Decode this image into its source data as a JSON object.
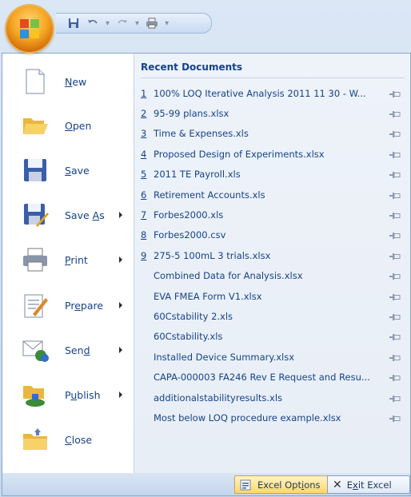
{
  "quick_access": {
    "icons": [
      "save-icon",
      "undo-icon",
      "redo-icon",
      "print-icon",
      "customize-icon"
    ]
  },
  "left_menu": [
    {
      "id": "new",
      "pre": "",
      "accel": "N",
      "post": "ew",
      "icon": "new-document-icon",
      "submenu": false
    },
    {
      "id": "open",
      "pre": "",
      "accel": "O",
      "post": "pen",
      "icon": "open-folder-icon",
      "submenu": false
    },
    {
      "id": "save",
      "pre": "",
      "accel": "S",
      "post": "ave",
      "icon": "save-disk-icon",
      "submenu": false
    },
    {
      "id": "save-as",
      "pre": "Save ",
      "accel": "A",
      "post": "s",
      "icon": "save-as-icon",
      "submenu": true
    },
    {
      "id": "print",
      "pre": "",
      "accel": "P",
      "post": "rint",
      "icon": "printer-icon",
      "submenu": true
    },
    {
      "id": "prepare",
      "pre": "Pr",
      "accel": "e",
      "post": "pare",
      "icon": "prepare-icon",
      "submenu": true
    },
    {
      "id": "send",
      "pre": "Sen",
      "accel": "d",
      "post": "",
      "icon": "send-icon",
      "submenu": true
    },
    {
      "id": "publish",
      "pre": "P",
      "accel": "u",
      "post": "blish",
      "icon": "publish-icon",
      "submenu": true
    },
    {
      "id": "close",
      "pre": "",
      "accel": "C",
      "post": "lose",
      "icon": "close-folder-icon",
      "submenu": false
    }
  ],
  "recent": {
    "title": "Recent Documents",
    "items": [
      {
        "num": "1",
        "name": "100% LOQ Iterative Analysis 2011 11 30 - W..."
      },
      {
        "num": "2",
        "name": "95-99 plans.xlsx"
      },
      {
        "num": "3",
        "name": "Time & Expenses.xls"
      },
      {
        "num": "4",
        "name": "Proposed Design of Experiments.xlsx"
      },
      {
        "num": "5",
        "name": "2011 TE Payroll.xls"
      },
      {
        "num": "6",
        "name": "Retirement Accounts.xls"
      },
      {
        "num": "7",
        "name": "Forbes2000.xls"
      },
      {
        "num": "8",
        "name": "Forbes2000.csv"
      },
      {
        "num": "9",
        "name": "275-5 100mL 3 trials.xlsx"
      },
      {
        "num": "",
        "name": "Combined Data for Analysis.xlsx"
      },
      {
        "num": "",
        "name": "EVA FMEA Form V1.xlsx"
      },
      {
        "num": "",
        "name": "60Cstability 2.xls"
      },
      {
        "num": "",
        "name": "60Cstability.xls"
      },
      {
        "num": "",
        "name": "Installed Device Summary.xlsx"
      },
      {
        "num": "",
        "name": "CAPA-000003 FA246 Rev E Request and Resu..."
      },
      {
        "num": "",
        "name": "additionalstabilityresults.xls"
      },
      {
        "num": "",
        "name": "Most below LOQ procedure example.xlsx"
      }
    ]
  },
  "footer": {
    "options": {
      "pre": "Excel Opt",
      "accel": "i",
      "post": "ons"
    },
    "exit": {
      "pre": "E",
      "accel": "x",
      "post": "it Excel"
    }
  }
}
